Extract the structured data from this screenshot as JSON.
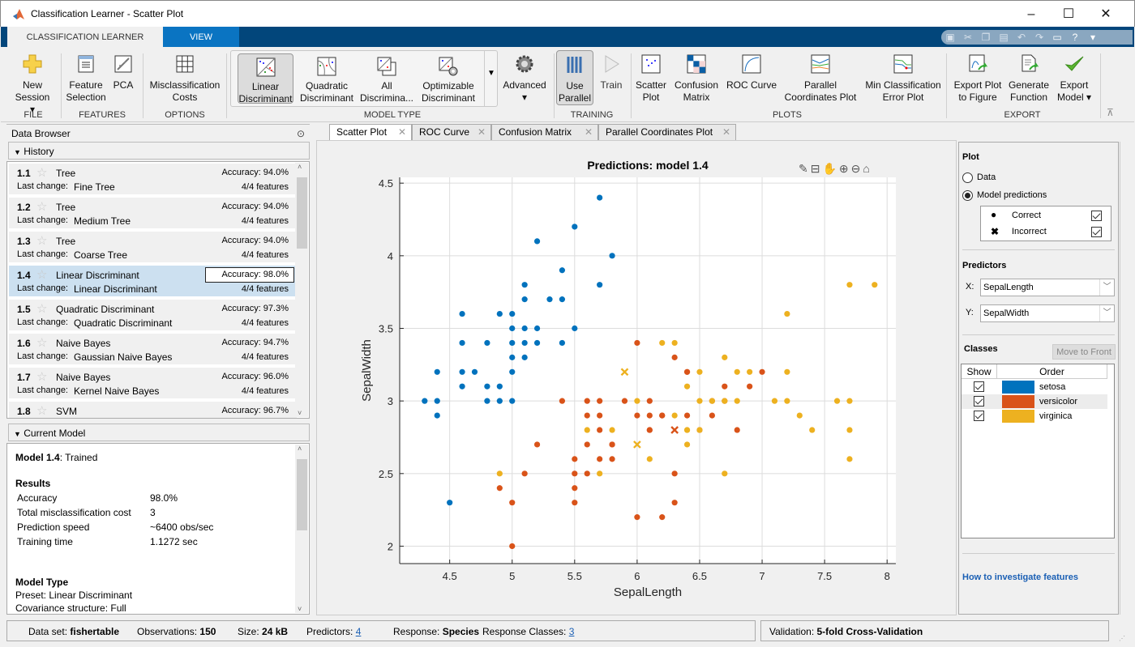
{
  "window": {
    "title": "Classification Learner - Scatter Plot",
    "minimize": "–",
    "maximize": "☐",
    "close": "✕"
  },
  "ribbon_tabs": [
    {
      "label": "CLASSIFICATION LEARNER"
    },
    {
      "label": "VIEW"
    }
  ],
  "quick_access": [
    "save-icon",
    "cut-icon",
    "copy-icon",
    "paste-icon",
    "undo-icon",
    "redo-icon",
    "window-icon",
    "help-icon",
    "menu-icon"
  ],
  "ribbon": {
    "file": {
      "new_session": "New",
      "new_session2": "Session ▾",
      "section": "FILE"
    },
    "features": {
      "feature_selection": "Feature",
      "feature_selection2": "Selection",
      "pca": "PCA",
      "section": "FEATURES"
    },
    "options": {
      "misclass": "Misclassification",
      "misclass2": "Costs",
      "section": "OPTIONS"
    },
    "model_type": {
      "items": [
        {
          "l1": "Linear",
          "l2": "Discriminant",
          "selected": true
        },
        {
          "l1": "Quadratic",
          "l2": "Discriminant"
        },
        {
          "l1": "All",
          "l2": "Discrimina..."
        },
        {
          "l1": "Optimizable",
          "l2": "Discriminant"
        }
      ],
      "advanced": "Advanced",
      "section": "MODEL TYPE"
    },
    "training": {
      "use_parallel": "Use",
      "use_parallel2": "Parallel",
      "train": "Train",
      "section": "TRAINING"
    },
    "plots": {
      "scatter": [
        "Scatter",
        "Plot"
      ],
      "confusion": [
        "Confusion",
        "Matrix"
      ],
      "roc": [
        "ROC Curve",
        ""
      ],
      "parallel": [
        "Parallel",
        "Coordinates Plot"
      ],
      "minerr": [
        "Min Classification",
        "Error Plot"
      ],
      "section": "PLOTS"
    },
    "export": {
      "plot": [
        "Export Plot",
        "to Figure"
      ],
      "gen": [
        "Generate",
        "Function"
      ],
      "model": [
        "Export",
        "Model ▾"
      ],
      "section": "EXPORT"
    }
  },
  "data_browser": {
    "title": "Data Browser",
    "history_label": "History",
    "history": [
      {
        "num": "1.1",
        "name": "Tree",
        "last_change": "Fine Tree",
        "accuracy": "Accuracy:  94.0%",
        "features": "4/4 features"
      },
      {
        "num": "1.2",
        "name": "Tree",
        "last_change": "Medium Tree",
        "accuracy": "Accuracy:  94.0%",
        "features": "4/4 features"
      },
      {
        "num": "1.3",
        "name": "Tree",
        "last_change": "Coarse Tree",
        "accuracy": "Accuracy:  94.0%",
        "features": "4/4 features"
      },
      {
        "num": "1.4",
        "name": "Linear Discriminant",
        "last_change": "Linear Discriminant",
        "accuracy": "Accuracy:  98.0%",
        "features": "4/4 features",
        "selected": true
      },
      {
        "num": "1.5",
        "name": "Quadratic Discriminant",
        "last_change": "Quadratic Discriminant",
        "accuracy": "Accuracy:  97.3%",
        "features": "4/4 features"
      },
      {
        "num": "1.6",
        "name": "Naive Bayes",
        "last_change": "Gaussian Naive Bayes",
        "accuracy": "Accuracy:  94.7%",
        "features": "4/4 features"
      },
      {
        "num": "1.7",
        "name": "Naive Bayes",
        "last_change": "Kernel Naive Bayes",
        "accuracy": "Accuracy:  96.0%",
        "features": "4/4 features"
      },
      {
        "num": "1.8",
        "name": "SVM",
        "last_change": "",
        "accuracy": "Accuracy:  96.7%",
        "features": ""
      }
    ],
    "last_change_label": "Last change:",
    "current_model_label": "Current Model",
    "current": {
      "model": "Model 1.4",
      "status": ": Trained",
      "results_label": "Results",
      "results": [
        {
          "k": "Accuracy",
          "v": "98.0%"
        },
        {
          "k": "Total misclassification cost",
          "v": "3"
        },
        {
          "k": "Prediction speed",
          "v": "~6400 obs/sec"
        },
        {
          "k": "Training time",
          "v": "1.1272 sec"
        }
      ],
      "model_type_label": "Model Type",
      "preset": "Preset: Linear Discriminant",
      "covariance": "Covariance structure: Full"
    }
  },
  "doc_tabs": [
    {
      "label": "Scatter Plot",
      "active": true
    },
    {
      "label": "ROC Curve"
    },
    {
      "label": "Confusion Matrix"
    },
    {
      "label": "Parallel Coordinates Plot"
    }
  ],
  "right_panel": {
    "plot_label": "Plot",
    "data_radio": "Data",
    "predictions_radio": "Model predictions",
    "correct": "Correct",
    "incorrect": "Incorrect",
    "predictors_label": "Predictors",
    "x_label": "X:",
    "x_value": "SepalLength",
    "y_label": "Y:",
    "y_value": "SepalWidth",
    "classes_label": "Classes",
    "move_front": "Move to Front",
    "show_col": "Show",
    "order_col": "Order",
    "classes": [
      {
        "name": "setosa",
        "color": "#0072bd"
      },
      {
        "name": "versicolor",
        "color": "#d95319"
      },
      {
        "name": "virginica",
        "color": "#edb120"
      }
    ],
    "help_link": "How to investigate features"
  },
  "status": {
    "dataset_label": "Data set:",
    "dataset": "fishertable",
    "obs_label": "Observations:",
    "obs": "150",
    "size_label": "Size:",
    "size": "24 kB",
    "pred_label": "Predictors:",
    "pred": "4",
    "resp_label": "Response:",
    "resp": "Species",
    "classes_label": "Response Classes:",
    "classes": "3",
    "validation_label": "Validation:",
    "validation": "5-fold Cross-Validation"
  },
  "chart_data": {
    "type": "scatter",
    "title": "Predictions: model 1.4",
    "xlabel": "SepalLength",
    "ylabel": "SepalWidth",
    "xlim": [
      4.1,
      8.07
    ],
    "ylim": [
      1.88,
      4.54
    ],
    "xticks": [
      4.5,
      5,
      5.5,
      6,
      6.5,
      7,
      7.5,
      8
    ],
    "yticks": [
      2,
      2.5,
      3,
      3.5,
      4,
      4.5
    ],
    "grid": true,
    "colors": {
      "setosa": "#0072bd",
      "versicolor": "#d95319",
      "virginica": "#edb120"
    },
    "series": [
      {
        "name": "setosa",
        "marker": "correct",
        "points": [
          [
            4.3,
            3.0
          ],
          [
            4.4,
            3.0
          ],
          [
            4.4,
            2.9
          ],
          [
            4.4,
            3.2
          ],
          [
            4.5,
            2.3
          ],
          [
            4.6,
            3.1
          ],
          [
            4.6,
            3.2
          ],
          [
            4.6,
            3.4
          ],
          [
            4.6,
            3.6
          ],
          [
            4.7,
            3.2
          ],
          [
            4.8,
            3.0
          ],
          [
            4.8,
            3.1
          ],
          [
            4.8,
            3.4
          ],
          [
            4.9,
            3.0
          ],
          [
            4.9,
            3.1
          ],
          [
            4.9,
            3.6
          ],
          [
            5.0,
            3.0
          ],
          [
            5.0,
            3.2
          ],
          [
            5.0,
            3.3
          ],
          [
            5.0,
            3.4
          ],
          [
            5.0,
            3.5
          ],
          [
            5.0,
            3.6
          ],
          [
            5.1,
            3.3
          ],
          [
            5.1,
            3.4
          ],
          [
            5.1,
            3.5
          ],
          [
            5.1,
            3.7
          ],
          [
            5.1,
            3.8
          ],
          [
            5.2,
            3.4
          ],
          [
            5.2,
            3.5
          ],
          [
            5.2,
            4.1
          ],
          [
            5.3,
            3.7
          ],
          [
            5.4,
            3.4
          ],
          [
            5.4,
            3.7
          ],
          [
            5.4,
            3.9
          ],
          [
            5.5,
            3.5
          ],
          [
            5.5,
            4.2
          ],
          [
            5.7,
            3.8
          ],
          [
            5.7,
            4.4
          ],
          [
            5.8,
            4.0
          ]
        ]
      },
      {
        "name": "versicolor",
        "marker": "correct",
        "points": [
          [
            4.9,
            2.4
          ],
          [
            5.0,
            2.0
          ],
          [
            5.0,
            2.3
          ],
          [
            5.1,
            2.5
          ],
          [
            5.2,
            2.7
          ],
          [
            5.4,
            3.0
          ],
          [
            5.5,
            2.3
          ],
          [
            5.5,
            2.4
          ],
          [
            5.5,
            2.5
          ],
          [
            5.5,
            2.6
          ],
          [
            5.6,
            2.5
          ],
          [
            5.6,
            2.7
          ],
          [
            5.6,
            2.9
          ],
          [
            5.6,
            3.0
          ],
          [
            5.7,
            2.6
          ],
          [
            5.7,
            2.8
          ],
          [
            5.7,
            2.9
          ],
          [
            5.7,
            3.0
          ],
          [
            5.8,
            2.6
          ],
          [
            5.8,
            2.7
          ],
          [
            5.9,
            3.0
          ],
          [
            6.0,
            2.2
          ],
          [
            6.0,
            2.9
          ],
          [
            6.0,
            3.4
          ],
          [
            6.1,
            2.8
          ],
          [
            6.1,
            2.9
          ],
          [
            6.1,
            3.0
          ],
          [
            6.2,
            2.2
          ],
          [
            6.2,
            2.9
          ],
          [
            6.3,
            2.3
          ],
          [
            6.3,
            2.5
          ],
          [
            6.3,
            3.3
          ],
          [
            6.4,
            2.9
          ],
          [
            6.4,
            3.2
          ],
          [
            6.5,
            2.8
          ],
          [
            6.6,
            2.9
          ],
          [
            6.6,
            3.0
          ],
          [
            6.7,
            3.0
          ],
          [
            6.7,
            3.1
          ],
          [
            6.8,
            2.8
          ],
          [
            6.9,
            3.1
          ],
          [
            7.0,
            3.2
          ],
          [
            6.4,
            3.2
          ],
          [
            5.8,
            2.7
          ],
          [
            6.2,
            2.9
          ],
          [
            6.1,
            2.8
          ]
        ]
      },
      {
        "name": "virginica",
        "marker": "correct",
        "points": [
          [
            4.9,
            2.5
          ],
          [
            5.6,
            2.8
          ],
          [
            5.7,
            2.5
          ],
          [
            5.8,
            2.8
          ],
          [
            6.0,
            3.0
          ],
          [
            6.1,
            2.6
          ],
          [
            6.2,
            3.4
          ],
          [
            6.3,
            2.9
          ],
          [
            6.3,
            3.4
          ],
          [
            6.4,
            2.7
          ],
          [
            6.4,
            2.8
          ],
          [
            6.4,
            3.1
          ],
          [
            6.5,
            2.8
          ],
          [
            6.5,
            3.0
          ],
          [
            6.5,
            3.2
          ],
          [
            6.7,
            2.5
          ],
          [
            6.7,
            3.0
          ],
          [
            6.7,
            3.3
          ],
          [
            6.8,
            3.0
          ],
          [
            6.8,
            3.2
          ],
          [
            6.9,
            3.2
          ],
          [
            7.1,
            3.0
          ],
          [
            7.2,
            3.0
          ],
          [
            7.2,
            3.2
          ],
          [
            7.2,
            3.6
          ],
          [
            7.3,
            2.9
          ],
          [
            7.4,
            2.8
          ],
          [
            7.6,
            3.0
          ],
          [
            7.7,
            2.6
          ],
          [
            7.7,
            2.8
          ],
          [
            7.7,
            3.0
          ],
          [
            7.7,
            3.8
          ],
          [
            7.9,
            3.8
          ],
          [
            6.6,
            3.0
          ],
          [
            6.4,
            2.8
          ]
        ]
      },
      {
        "name": "virginica",
        "marker": "incorrect",
        "points": [
          [
            5.9,
            3.2
          ],
          [
            6.0,
            2.7
          ]
        ]
      },
      {
        "name": "versicolor",
        "marker": "incorrect",
        "points": [
          [
            6.3,
            2.8
          ]
        ]
      }
    ]
  }
}
